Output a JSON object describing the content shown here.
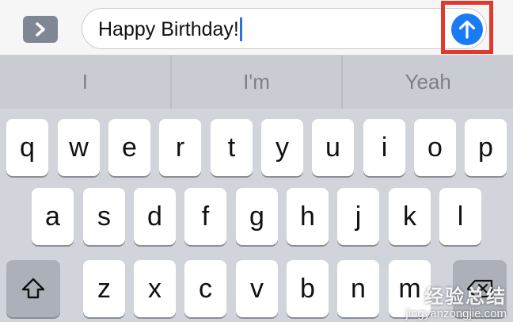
{
  "input": {
    "text": "Happy Birthday!"
  },
  "predictive": {
    "suggestions": [
      "I",
      "I'm",
      "Yeah"
    ]
  },
  "keyboard": {
    "row1": [
      "q",
      "w",
      "e",
      "r",
      "t",
      "y",
      "u",
      "i",
      "o",
      "p"
    ],
    "row2": [
      "a",
      "s",
      "d",
      "f",
      "g",
      "h",
      "j",
      "k",
      "l"
    ],
    "row3": [
      "z",
      "x",
      "c",
      "v",
      "b",
      "n",
      "m"
    ]
  },
  "icons": {
    "expand": "chevron-right-icon",
    "send": "arrow-up-icon",
    "shift": "shift-icon",
    "delete": "delete-icon"
  },
  "colors": {
    "send_button": "#1a7bf5",
    "highlight_box": "#e03a2f",
    "caret": "#2f6fe4"
  },
  "watermark": {
    "line1": "经验总结",
    "line2": "jingyanzongjie.com"
  }
}
